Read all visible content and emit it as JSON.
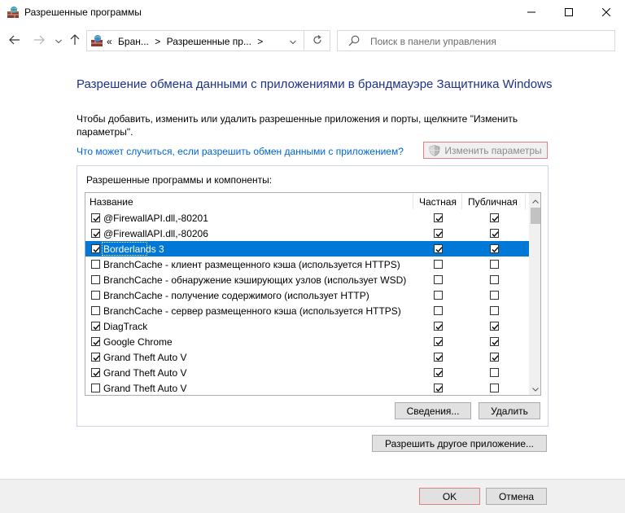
{
  "window": {
    "title": "Разрешенные программы",
    "icon": "firewall-app-icon"
  },
  "address": {
    "back_icon": "arrow-left-icon",
    "forward_icon": "arrow-right-icon",
    "recent_icon": "chevron-down-icon",
    "up_icon": "arrow-up-icon",
    "overflow": "«",
    "crumbs": [
      "Бран...",
      "Разрешенные пр..."
    ],
    "separator": ">",
    "search_placeholder": "Поиск в панели управления"
  },
  "header": {
    "title": "Разрешение обмена данными с приложениями в брандмауэре Защитника Windows",
    "description": "Чтобы добавить, изменить или удалить разрешенные приложения и порты, щелкните \"Изменить параметры\".",
    "help_link": "Что может случиться, если разрешить обмен данными с приложением?",
    "change_settings": "Изменить параметры"
  },
  "group": {
    "label": "Разрешенные программы и компоненты:",
    "columns": {
      "name": "Название",
      "private": "Частная",
      "public": "Публичная"
    },
    "rows": [
      {
        "name": "@FirewallAPI.dll,-80201",
        "checked": true,
        "private": true,
        "public": true,
        "selected": false
      },
      {
        "name": "@FirewallAPI.dll,-80206",
        "checked": true,
        "private": true,
        "public": true,
        "selected": false
      },
      {
        "name": "Borderlands 3",
        "checked": true,
        "private": true,
        "public": true,
        "selected": true
      },
      {
        "name": "BranchCache - клиент размещенного кэша (используется HTTPS)",
        "checked": false,
        "private": false,
        "public": false,
        "selected": false
      },
      {
        "name": "BranchCache - обнаружение кэширующих узлов (использует WSD)",
        "checked": false,
        "private": false,
        "public": false,
        "selected": false
      },
      {
        "name": "BranchCache - получение содержимого (использует HTTP)",
        "checked": false,
        "private": false,
        "public": false,
        "selected": false
      },
      {
        "name": "BranchCache - сервер размещенного кэша (используется HTTPS)",
        "checked": false,
        "private": false,
        "public": false,
        "selected": false
      },
      {
        "name": "DiagTrack",
        "checked": true,
        "private": true,
        "public": true,
        "selected": false
      },
      {
        "name": "Google Chrome",
        "checked": true,
        "private": true,
        "public": true,
        "selected": false
      },
      {
        "name": "Grand Theft Auto V",
        "checked": true,
        "private": true,
        "public": true,
        "selected": false
      },
      {
        "name": "Grand Theft Auto V",
        "checked": true,
        "private": true,
        "public": false,
        "selected": false
      },
      {
        "name": "Grand Theft Auto V",
        "checked": false,
        "private": true,
        "public": false,
        "selected": false
      }
    ],
    "details_button": "Сведения...",
    "remove_button": "Удалить"
  },
  "allow_other_button": "Разрешить другое приложение...",
  "footer": {
    "ok": "OK",
    "cancel": "Отмена"
  },
  "colors": {
    "heading": "#1e3287",
    "link": "#0066cc",
    "selection": "#0078d7",
    "focus_border": "#e08080"
  }
}
